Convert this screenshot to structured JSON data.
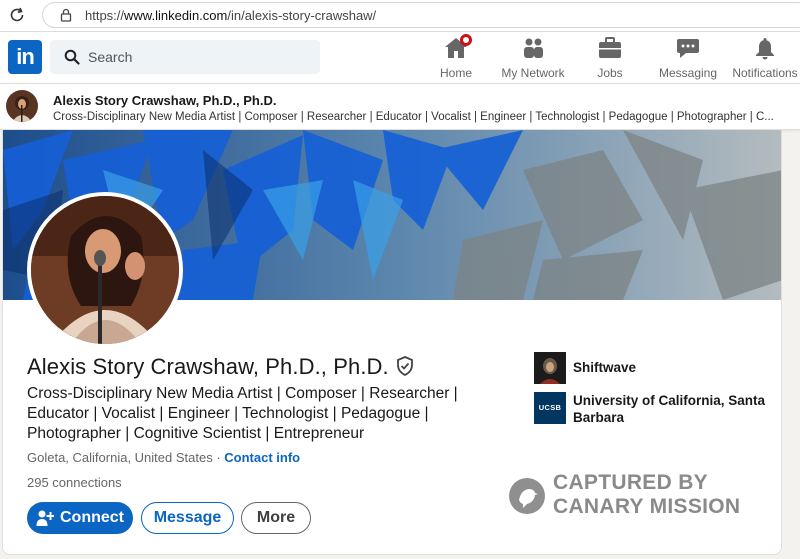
{
  "browser": {
    "url_prefix": "https://",
    "url_host": "www.linkedin.com",
    "url_path": "/in/alexis-story-crawshaw/"
  },
  "nav": {
    "logo": "in",
    "search_placeholder": "Search",
    "items": [
      {
        "label": "Home",
        "icon": "home-icon"
      },
      {
        "label": "My Network",
        "icon": "network-icon"
      },
      {
        "label": "Jobs",
        "icon": "briefcase-icon"
      },
      {
        "label": "Messaging",
        "icon": "chat-icon"
      },
      {
        "label": "Notifications",
        "icon": "bell-icon"
      }
    ]
  },
  "mini_header": {
    "name": "Alexis Story Crawshaw, Ph.D., Ph.D.",
    "headline": "Cross-Disciplinary New Media Artist | Composer | Researcher | Educator | Vocalist | Engineer | Technologist | Pedagogue | Photographer | C..."
  },
  "profile": {
    "name": "Alexis Story Crawshaw, Ph.D., Ph.D.",
    "headline": "Cross-Disciplinary New Media Artist | Composer | Researcher | Educator | Vocalist | Engineer | Technologist | Pedagogue | Photographer | Cognitive Scientist | Entrepreneur",
    "location": "Goleta, California, United States",
    "separator": " · ",
    "contact_label": "Contact info",
    "connections": "295 connections"
  },
  "actions": {
    "connect": "Connect",
    "message": "Message",
    "more": "More"
  },
  "organizations": [
    {
      "name": "Shiftwave"
    },
    {
      "name": "University of California, Santa Barbara",
      "logo_text": "UCSB"
    }
  ],
  "watermark": {
    "line1": "CAPTURED BY",
    "line2": "CANARY MISSION"
  },
  "colors": {
    "linkedin_blue": "#0a66c2",
    "notification_red": "#cc1016",
    "page_bg": "#f4f2ee"
  }
}
